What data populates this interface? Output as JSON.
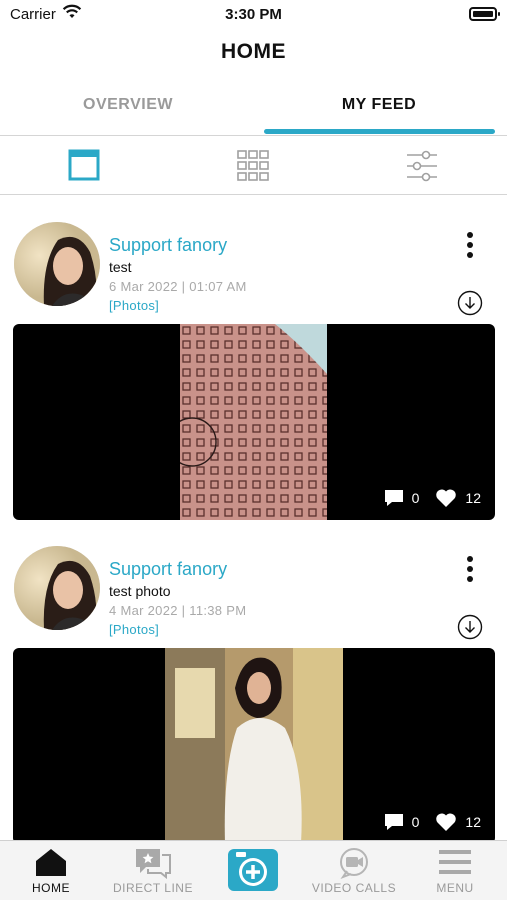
{
  "status_bar": {
    "carrier": "Carrier",
    "time": "3:30 PM"
  },
  "header": {
    "title": "HOME"
  },
  "tabs": [
    {
      "label": "OVERVIEW",
      "active": false
    },
    {
      "label": "MY FEED",
      "active": true
    }
  ],
  "view_modes": [
    {
      "icon": "list-view-icon",
      "active": true
    },
    {
      "icon": "grid-view-icon",
      "active": false
    },
    {
      "icon": "filter-sliders-icon",
      "active": false
    }
  ],
  "posts": [
    {
      "author": "Support fanory",
      "text": "test",
      "date": "6 Mar 2022 | 01:07 AM",
      "tag": "[Photos]",
      "comments": "0",
      "likes": "12"
    },
    {
      "author": "Support fanory",
      "text": "test photo",
      "date": "4 Mar 2022 | 11:38 PM",
      "tag": "[Photos]",
      "comments": "0",
      "likes": "12"
    }
  ],
  "tab_bar": {
    "home": "HOME",
    "direct_line": "DIRECT LINE",
    "video_calls": "VIDEO CALLS",
    "menu": "MENU"
  },
  "colors": {
    "accent": "#2ba8c7",
    "muted": "#9a9a9a"
  }
}
